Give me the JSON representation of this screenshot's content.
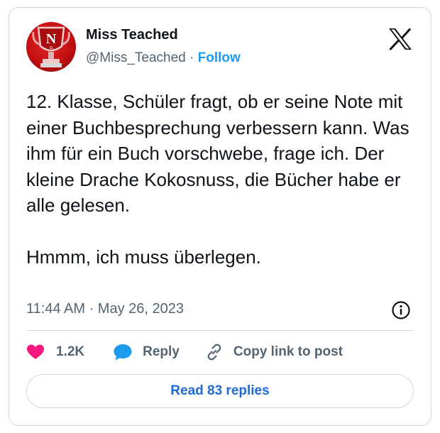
{
  "author": {
    "name": "Miss Teached",
    "handle": "@Miss_Teached",
    "separator": "·",
    "follow_label": "Follow",
    "avatar_icon": "trophy-avatar-icon"
  },
  "tweet": {
    "text": "12. Klasse, Schüler fragt, ob er seine Note mit einer Buchbesprechung verbessern kann. Was ihm für ein Buch vorschwebe, frage ich. Der kleine Drache Kokosnuss, die Bücher habe er alle gelesen.\n\nHmmm, ich muss überlegen.",
    "timestamp": "11:44 AM · May 26, 2023"
  },
  "actions": {
    "like_count": "1.2K",
    "reply_label": "Reply",
    "copy_label": "Copy link to post",
    "like_icon": "heart-icon",
    "reply_icon": "speech-bubble-icon",
    "copy_icon": "link-icon"
  },
  "footer": {
    "read_replies_label": "Read 83 replies"
  },
  "colors": {
    "accent": "#1d9bf0",
    "like": "#f91880",
    "muted_text": "#536471",
    "border": "#cfd9de"
  }
}
